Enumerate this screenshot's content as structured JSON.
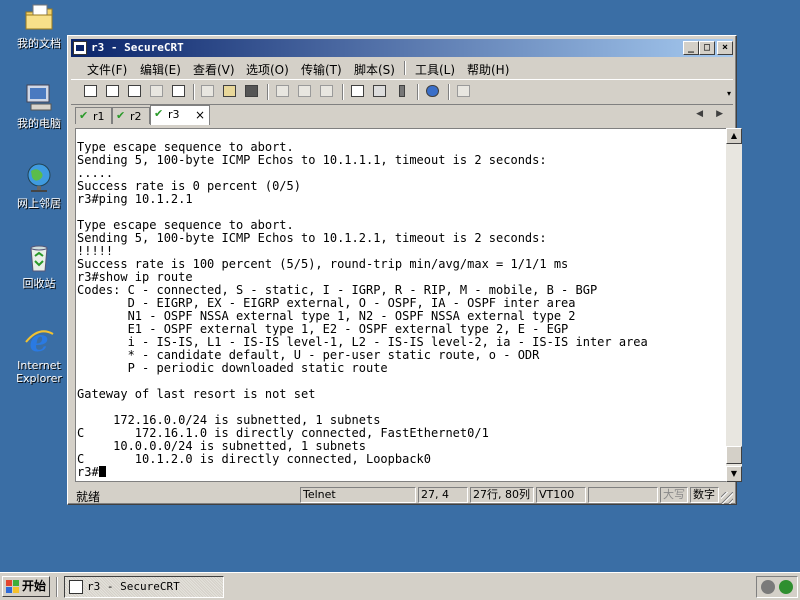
{
  "desktop": {
    "icons": [
      {
        "label": "我的文档",
        "icon": "my-documents-icon"
      },
      {
        "label": "我的电脑",
        "icon": "my-computer-icon"
      },
      {
        "label": "网上邻居",
        "icon": "network-places-icon"
      },
      {
        "label": "回收站",
        "icon": "recycle-bin-icon"
      },
      {
        "label": "Internet Explorer",
        "icon": "internet-explorer-icon"
      }
    ]
  },
  "window": {
    "title": "r3 - SecureCRT",
    "controls": [
      "_",
      "□",
      "×"
    ],
    "menu": [
      "文件(F)",
      "编辑(E)",
      "查看(V)",
      "选项(O)",
      "传输(T)",
      "脚本(S)",
      "工具(L)",
      "帮助(H)"
    ],
    "tabs": [
      {
        "label": "r1",
        "active": false
      },
      {
        "label": "r2",
        "active": false
      },
      {
        "label": "r3",
        "active": true
      }
    ],
    "tab_close": "×",
    "terminal_lines": [
      "Type escape sequence to abort.",
      "Sending 5, 100-byte ICMP Echos to 10.1.1.1, timeout is 2 seconds:",
      ".....",
      "Success rate is 0 percent (0/5)",
      "r3#ping 10.1.2.1",
      "",
      "Type escape sequence to abort.",
      "Sending 5, 100-byte ICMP Echos to 10.1.2.1, timeout is 2 seconds:",
      "!!!!!",
      "Success rate is 100 percent (5/5), round-trip min/avg/max = 1/1/1 ms",
      "r3#show ip route",
      "Codes: C - connected, S - static, I - IGRP, R - RIP, M - mobile, B - BGP",
      "       D - EIGRP, EX - EIGRP external, O - OSPF, IA - OSPF inter area",
      "       N1 - OSPF NSSA external type 1, N2 - OSPF NSSA external type 2",
      "       E1 - OSPF external type 1, E2 - OSPF external type 2, E - EGP",
      "       i - IS-IS, L1 - IS-IS level-1, L2 - IS-IS level-2, ia - IS-IS inter area",
      "       * - candidate default, U - per-user static route, o - ODR",
      "       P - periodic downloaded static route",
      "",
      "Gateway of last resort is not set",
      "",
      "     172.16.0.0/24 is subnetted, 1 subnets",
      "C       172.16.1.0 is directly connected, FastEthernet0/1",
      "     10.0.0.0/24 is subnetted, 1 subnets",
      "C       10.1.2.0 is directly connected, Loopback0"
    ],
    "prompt": "r3#",
    "status": {
      "ready": "就绪",
      "protocol": "Telnet",
      "cursor_pos": "27,  4",
      "size": "27行, 80列",
      "emulation": "VT100",
      "blank": "",
      "caps": "大写",
      "num": "数字"
    }
  },
  "taskbar": {
    "start_label": "开始",
    "task_label": "r3 - SecureCRT"
  }
}
